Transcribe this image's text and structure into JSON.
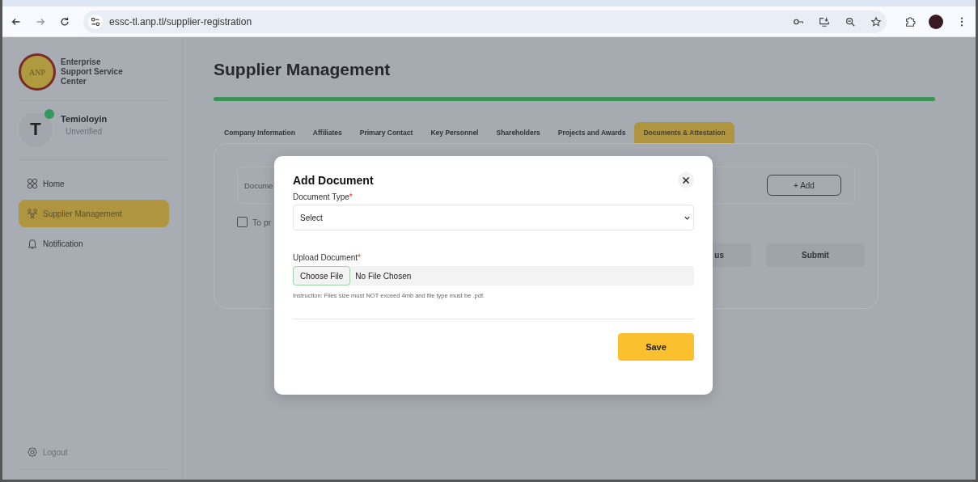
{
  "browser": {
    "url": "essc-tl.anp.tl/supplier-registration"
  },
  "sidebar": {
    "logo_text": "ANP",
    "org_name": "Enterprise Support Service Center",
    "user": {
      "initial": "T",
      "name": "Temioloyin",
      "status": "Unverified",
      "online": true
    },
    "nav": [
      {
        "label": "Home",
        "kind": "grid",
        "selected": false
      },
      {
        "label": "Supplier Management",
        "kind": "people",
        "selected": true
      },
      {
        "label": "Notification",
        "kind": "bell",
        "selected": false
      }
    ],
    "logout": "Logout"
  },
  "page": {
    "title": "Supplier Management",
    "progress": {
      "level": 1
    },
    "tabs": [
      {
        "label": "Company Information",
        "selected": false
      },
      {
        "label": "Affiliates",
        "selected": false
      },
      {
        "label": "Primary Contact",
        "selected": false
      },
      {
        "label": "Key Personnel",
        "selected": false
      },
      {
        "label": "Shareholders",
        "selected": false
      },
      {
        "label": "Projects and Awards",
        "selected": false
      },
      {
        "label": "Documents & Attestation",
        "selected": true
      }
    ],
    "document_field": {
      "placeholder": "Docume"
    },
    "add_button": "+ Add",
    "consent": {
      "label": "To pr",
      "checked": false
    },
    "previous_button": "us",
    "submit_button": "Submit"
  },
  "modal": {
    "title": "Add Document",
    "document_type": {
      "label": "Document Type",
      "required_mark": "*",
      "value": "Select"
    },
    "upload": {
      "label": "Upload Document",
      "required_mark": "*",
      "button": "Choose File",
      "file": "No File Chosen",
      "instruction": "Instruction: Files size must NOT exceed 4mb and file type must be .pdf."
    },
    "save_button": "Save"
  }
}
